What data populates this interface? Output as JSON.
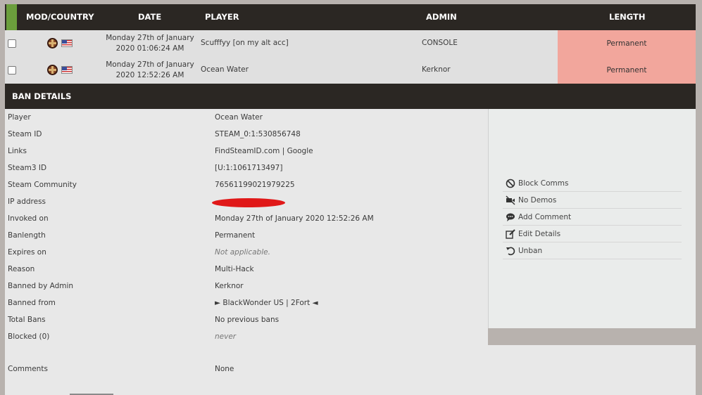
{
  "header": {
    "mod_country": "MOD/COUNTRY",
    "date": "DATE",
    "player": "PLAYER",
    "admin": "ADMIN",
    "length": "LENGTH"
  },
  "bans": [
    {
      "date_line1": "Monday 27th of January",
      "date_line2": "2020 01:06:24 AM",
      "player": "Scufffyy [on my alt acc]",
      "admin": "CONSOLE",
      "length": "Permanent"
    },
    {
      "date_line1": "Monday 27th of January",
      "date_line2": "2020 12:52:26 AM",
      "player": "Ocean Water",
      "admin": "Kerknor",
      "length": "Permanent"
    }
  ],
  "ban_details": {
    "title": "BAN DETAILS",
    "rows": [
      {
        "label": "Player",
        "value": "Ocean Water"
      },
      {
        "label": "Steam ID",
        "value": "STEAM_0:1:530856748"
      },
      {
        "label": "Links",
        "value": "FindSteamID.com | Google"
      },
      {
        "label": "Steam3 ID",
        "value": "[U:1:1061713497]"
      },
      {
        "label": "Steam Community",
        "value": "76561199021979225"
      },
      {
        "label": "IP address",
        "value": ""
      },
      {
        "label": "Invoked on",
        "value": "Monday 27th of January 2020 12:52:26 AM"
      },
      {
        "label": "Banlength",
        "value": "Permanent"
      },
      {
        "label": "Expires on",
        "value": "Not applicable."
      },
      {
        "label": "Reason",
        "value": "Multi-Hack"
      },
      {
        "label": "Banned by Admin",
        "value": "Kerknor"
      },
      {
        "label": "Banned from",
        "value": "► BlackWonder US | 2Fort ◄"
      },
      {
        "label": "Total Bans",
        "value": "No previous bans"
      },
      {
        "label": "Blocked (0)",
        "value": "never"
      },
      {
        "label": "Comments",
        "value": "None"
      }
    ]
  },
  "actions": [
    {
      "label": "Block Comms",
      "icon": "block-icon"
    },
    {
      "label": "No Demos",
      "icon": "no-video-icon"
    },
    {
      "label": "Add Comment",
      "icon": "comment-icon"
    },
    {
      "label": "Edit Details",
      "icon": "edit-icon"
    },
    {
      "label": "Unban",
      "icon": "undo-icon"
    }
  ],
  "colors": {
    "header_bg": "#2b2723",
    "permanent_bg": "#f2a69c",
    "redaction": "#e01818",
    "select_all_square": "#6b9e3c"
  }
}
